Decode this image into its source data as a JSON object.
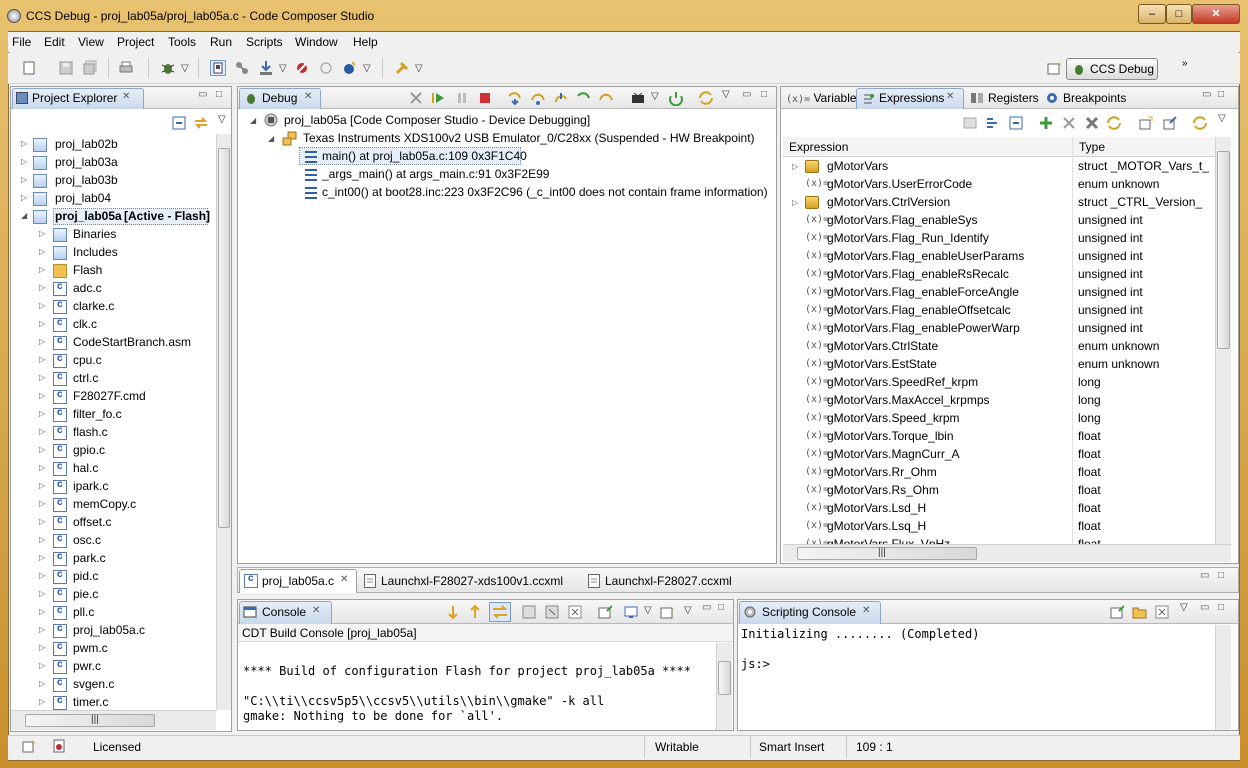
{
  "window": {
    "title": "CCS Debug - proj_lab05a/proj_lab05a.c - Code Composer Studio",
    "min": "‒",
    "max": "□",
    "close": "✕"
  },
  "menu": [
    "File",
    "Edit",
    "View",
    "Project",
    "Tools",
    "Run",
    "Scripts",
    "Window",
    "Help"
  ],
  "perspective": {
    "label": "CCS Debug",
    "more": "»"
  },
  "project_explorer": {
    "tab_label": "Project Explorer",
    "projects": [
      "proj_lab02b",
      "proj_lab03a",
      "proj_lab03b",
      "proj_lab04"
    ],
    "active_project": "proj_lab05a",
    "active_suffix": "[Active - Flash]",
    "children": [
      "Binaries",
      "Includes",
      "Flash",
      "adc.c",
      "clarke.c",
      "clk.c",
      "CodeStartBranch.asm",
      "cpu.c",
      "ctrl.c",
      "F28027F.cmd",
      "filter_fo.c",
      "flash.c",
      "gpio.c",
      "hal.c",
      "ipark.c",
      "memCopy.c",
      "offset.c",
      "osc.c",
      "park.c",
      "pid.c",
      "pie.c",
      "pll.c",
      "proj_lab05a.c",
      "pwm.c",
      "pwr.c",
      "svgen.c",
      "timer.c"
    ]
  },
  "debug": {
    "tab_label": "Debug",
    "session": "proj_lab05a [Code Composer Studio - Device Debugging]",
    "target": "Texas Instruments XDS100v2 USB Emulator_0/C28xx (Suspended - HW Breakpoint)",
    "frames": [
      "main() at proj_lab05a.c:109 0x3F1C40",
      "_args_main() at args_main.c:91 0x3F2E99",
      "c_int00() at boot28.inc:223 0x3F2C96  (_c_int00 does not contain frame information)"
    ]
  },
  "expressions": {
    "tabs": [
      "Variables",
      "Expressions",
      "Registers",
      "Breakpoints"
    ],
    "col_expression": "Expression",
    "col_type": "Type",
    "rows": [
      {
        "name": "gMotorVars",
        "type": "struct _MOTOR_Vars_t_",
        "expandable": true
      },
      {
        "name": "gMotorVars.UserErrorCode",
        "type": "enum unknown",
        "expandable": false
      },
      {
        "name": "gMotorVars.CtrlVersion",
        "type": "struct _CTRL_Version_",
        "expandable": true
      },
      {
        "name": "gMotorVars.Flag_enableSys",
        "type": "unsigned int",
        "expandable": false
      },
      {
        "name": "gMotorVars.Flag_Run_Identify",
        "type": "unsigned int",
        "expandable": false
      },
      {
        "name": "gMotorVars.Flag_enableUserParams",
        "type": "unsigned int",
        "expandable": false
      },
      {
        "name": "gMotorVars.Flag_enableRsRecalc",
        "type": "unsigned int",
        "expandable": false
      },
      {
        "name": "gMotorVars.Flag_enableForceAngle",
        "type": "unsigned int",
        "expandable": false
      },
      {
        "name": "gMotorVars.Flag_enableOffsetcalc",
        "type": "unsigned int",
        "expandable": false
      },
      {
        "name": "gMotorVars.Flag_enablePowerWarp",
        "type": "unsigned int",
        "expandable": false
      },
      {
        "name": "gMotorVars.CtrlState",
        "type": "enum unknown",
        "expandable": false
      },
      {
        "name": "gMotorVars.EstState",
        "type": "enum unknown",
        "expandable": false
      },
      {
        "name": "gMotorVars.SpeedRef_krpm",
        "type": "long",
        "expandable": false
      },
      {
        "name": "gMotorVars.MaxAccel_krpmps",
        "type": "long",
        "expandable": false
      },
      {
        "name": "gMotorVars.Speed_krpm",
        "type": "long",
        "expandable": false
      },
      {
        "name": "gMotorVars.Torque_lbin",
        "type": "float",
        "expandable": false
      },
      {
        "name": "gMotorVars.MagnCurr_A",
        "type": "float",
        "expandable": false
      },
      {
        "name": "gMotorVars.Rr_Ohm",
        "type": "float",
        "expandable": false
      },
      {
        "name": "gMotorVars.Rs_Ohm",
        "type": "float",
        "expandable": false
      },
      {
        "name": "gMotorVars.Lsd_H",
        "type": "float",
        "expandable": false
      },
      {
        "name": "gMotorVars.Lsq_H",
        "type": "float",
        "expandable": false
      },
      {
        "name": "gMotorVars.Flux_VpHz",
        "type": "float",
        "expandable": false
      }
    ]
  },
  "editor_tabs": [
    "proj_lab05a.c",
    "Launchxl-F28027-xds100v1.ccxml",
    "Launchxl-F28027.ccxml"
  ],
  "console": {
    "tab_label": "Console",
    "subtitle": "CDT Build Console [proj_lab05a]",
    "lines": [
      "",
      "**** Build of configuration Flash for project proj_lab05a ****",
      "",
      "\"C:\\\\ti\\\\ccsv5p5\\\\ccsv5\\\\utils\\\\bin\\\\gmake\" -k all",
      "gmake: Nothing to be done for `all'."
    ]
  },
  "scripting_console": {
    "tab_label": "Scripting Console",
    "lines": [
      "Initializing ........ (Completed)",
      "",
      "js:>"
    ]
  },
  "status": {
    "licensed": "Licensed",
    "writable": "Writable",
    "insert_mode": "Smart Insert",
    "position": "109 : 1"
  },
  "glyphs": {
    "expanded": "◢",
    "collapsed": "▷",
    "close": "✕",
    "min": "▭",
    "max": "□",
    "menu": "▽",
    "var": "(x)=",
    "grip": "|||"
  }
}
